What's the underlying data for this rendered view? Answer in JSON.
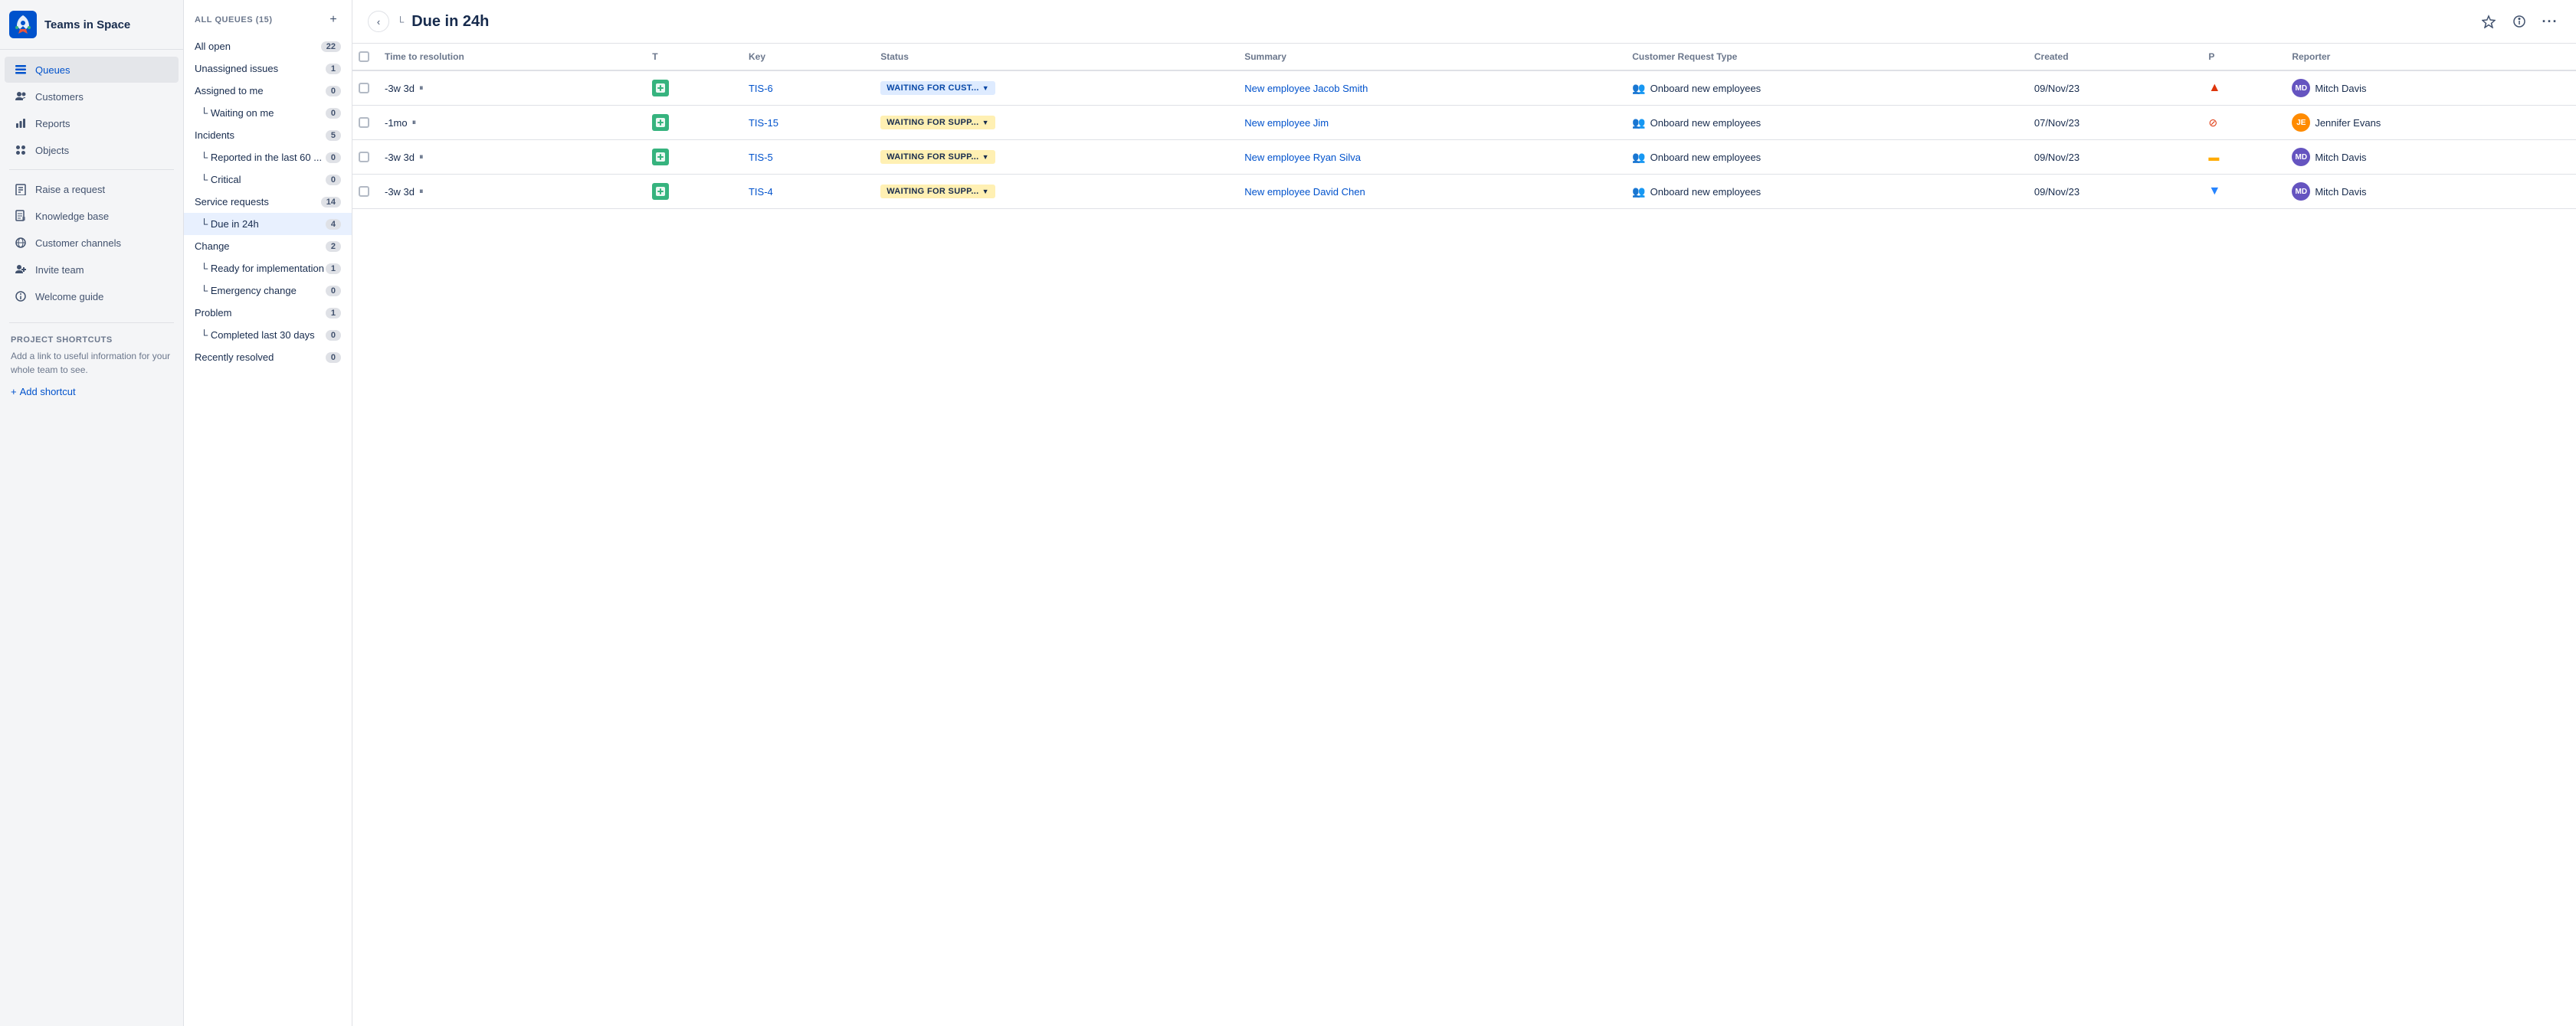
{
  "app": {
    "title": "Teams in Space"
  },
  "sidebar": {
    "nav_items": [
      {
        "id": "queues",
        "label": "Queues",
        "icon": "queues",
        "active": true
      },
      {
        "id": "customers",
        "label": "Customers",
        "icon": "customers",
        "active": false
      },
      {
        "id": "reports",
        "label": "Reports",
        "icon": "reports",
        "active": false
      },
      {
        "id": "objects",
        "label": "Objects",
        "icon": "objects",
        "active": false
      }
    ],
    "secondary_items": [
      {
        "id": "raise-request",
        "label": "Raise a request",
        "icon": "raise"
      },
      {
        "id": "knowledge-base",
        "label": "Knowledge base",
        "icon": "knowledge"
      },
      {
        "id": "customer-channels",
        "label": "Customer channels",
        "icon": "channels"
      },
      {
        "id": "invite-team",
        "label": "Invite team",
        "icon": "invite"
      },
      {
        "id": "welcome-guide",
        "label": "Welcome guide",
        "icon": "welcome"
      }
    ],
    "shortcuts": {
      "label": "PROJECT SHORTCUTS",
      "description": "Add a link to useful information for your whole team to see.",
      "add_label": "Add shortcut"
    }
  },
  "queue_panel": {
    "header": "ALL QUEUES (15)",
    "items": [
      {
        "name": "All open",
        "count": "22",
        "indent": false,
        "active": false
      },
      {
        "name": "Unassigned issues",
        "count": "1",
        "indent": false,
        "active": false
      },
      {
        "name": "Assigned to me",
        "count": "0",
        "indent": false,
        "active": false
      },
      {
        "name": "└ Waiting on me",
        "count": "0",
        "indent": true,
        "active": false
      },
      {
        "name": "Incidents",
        "count": "5",
        "indent": false,
        "active": false
      },
      {
        "name": "└ Reported in the last 60 ...",
        "count": "0",
        "indent": true,
        "active": false
      },
      {
        "name": "└ Critical",
        "count": "0",
        "indent": true,
        "active": false
      },
      {
        "name": "Service requests",
        "count": "14",
        "indent": false,
        "active": false
      },
      {
        "name": "└ Due in 24h",
        "count": "4",
        "indent": true,
        "active": true
      },
      {
        "name": "Change",
        "count": "2",
        "indent": false,
        "active": false
      },
      {
        "name": "└ Ready for implementation",
        "count": "1",
        "indent": true,
        "active": false
      },
      {
        "name": "└ Emergency change",
        "count": "0",
        "indent": true,
        "active": false
      },
      {
        "name": "Problem",
        "count": "1",
        "indent": false,
        "active": false
      },
      {
        "name": "└ Completed last 30 days",
        "count": "0",
        "indent": true,
        "active": false
      },
      {
        "name": "Recently resolved",
        "count": "0",
        "indent": false,
        "active": false
      }
    ]
  },
  "main": {
    "title": "Due in 24h",
    "breadcrumb_prefix": "└",
    "columns": [
      {
        "id": "checkbox",
        "label": ""
      },
      {
        "id": "time",
        "label": "Time to resolution"
      },
      {
        "id": "type",
        "label": "T"
      },
      {
        "id": "key",
        "label": "Key"
      },
      {
        "id": "status",
        "label": "Status"
      },
      {
        "id": "summary",
        "label": "Summary"
      },
      {
        "id": "request_type",
        "label": "Customer Request Type"
      },
      {
        "id": "created",
        "label": "Created"
      },
      {
        "id": "priority",
        "label": "P"
      },
      {
        "id": "reporter",
        "label": "Reporter"
      }
    ],
    "rows": [
      {
        "id": 1,
        "time": "-3w 3d",
        "key": "TIS-6",
        "status": "WAITING FOR CUST...",
        "status_type": "customer",
        "summary": "New employee Jacob Smith",
        "request_type": "Onboard new employees",
        "created": "09/Nov/23",
        "priority": "high",
        "reporter_name": "Mitch Davis",
        "reporter_color": "#6554c0"
      },
      {
        "id": 2,
        "time": "-1mo",
        "key": "TIS-15",
        "status": "WAITING FOR SUPP...",
        "status_type": "support",
        "summary": "New employee Jim",
        "request_type": "Onboard new employees",
        "created": "07/Nov/23",
        "priority": "block",
        "reporter_name": "Jennifer Evans",
        "reporter_color": "#ff8b00"
      },
      {
        "id": 3,
        "time": "-3w 3d",
        "key": "TIS-5",
        "status": "WAITING FOR SUPP...",
        "status_type": "support",
        "summary": "New employee Ryan Silva",
        "request_type": "Onboard new employees",
        "created": "09/Nov/23",
        "priority": "medium",
        "reporter_name": "Mitch Davis",
        "reporter_color": "#6554c0"
      },
      {
        "id": 4,
        "time": "-3w 3d",
        "key": "TIS-4",
        "status": "WAITING FOR SUPP...",
        "status_type": "support",
        "summary": "New employee David Chen",
        "request_type": "Onboard new employees",
        "created": "09/Nov/23",
        "priority": "low",
        "reporter_name": "Mitch Davis",
        "reporter_color": "#6554c0"
      }
    ]
  }
}
